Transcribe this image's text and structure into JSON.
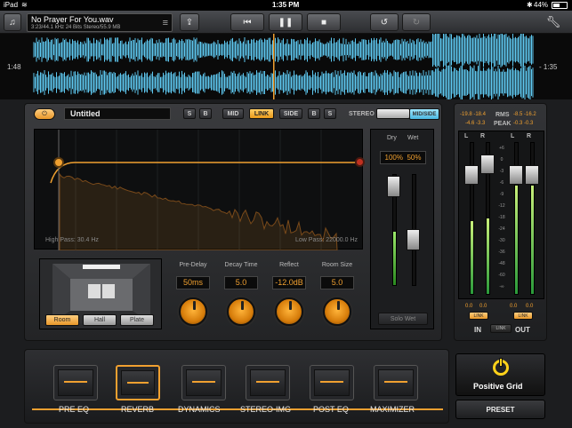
{
  "status": {
    "carrier": "iPad",
    "time": "1:35 PM",
    "battery": "44%"
  },
  "file": {
    "name": "No Prayer For You.wav",
    "details": "3:23/44.1 kHz 24 Bits Stereo/55.9 MB"
  },
  "waveform": {
    "elapsed": "1:48",
    "remaining": "- 1:35",
    "playhead_fraction": 0.48
  },
  "preset": {
    "name": "Untitled"
  },
  "mode_buttons": [
    "S",
    "B",
    "MID",
    "LINK",
    "SIDE",
    "B",
    "S"
  ],
  "stereo": {
    "label": "STEREO",
    "toggle_label": "MID/SIDE"
  },
  "eq_graph": {
    "high_pass": "High Pass: 30.4 Hz",
    "low_pass": "Low Pass: 22000.0 Hz"
  },
  "mix": {
    "dry_label": "Dry",
    "wet_label": "Wet",
    "dry_value": "100%",
    "wet_value": "50%",
    "solo_label": "Solo Wet"
  },
  "room_types": [
    "Room",
    "Hall",
    "Plate"
  ],
  "params": [
    {
      "label": "Pre-Delay",
      "value": "50ms"
    },
    {
      "label": "Decay Time",
      "value": "5.0"
    },
    {
      "label": "Reflect",
      "value": "-12.0dB"
    },
    {
      "label": "Room Size",
      "value": "5.0"
    }
  ],
  "meters": {
    "rms_label": "RMS",
    "peak_label": "PEAK",
    "in_rms": "-19.8 -18.4",
    "out_rms": "-8.5 -16.2",
    "in_peak": "-4.6 -3.3",
    "out_peak": "-0.3 -0.3",
    "channel_labels": [
      "L",
      "R",
      "L",
      "R"
    ],
    "scale": [
      "+6",
      "0",
      "-3",
      "-6",
      "-9",
      "-12",
      "-18",
      "-24",
      "-30",
      "-36",
      "-48",
      "-60",
      "-∞"
    ],
    "in_gain": [
      "0.0",
      "0.0"
    ],
    "out_gain": [
      "0.0",
      "0.0"
    ],
    "link_label": "LINK",
    "in_label": "IN",
    "out_label": "OUT"
  },
  "chain": [
    "PRE EQ",
    "REVERB",
    "DYNAMICS",
    "STEREO-IMG",
    "POST EQ",
    "MAXIMIZER"
  ],
  "brand": {
    "name": "Positive Grid",
    "preset_label": "PRESET"
  },
  "colors": {
    "accent": "#f0a030",
    "wave": "#5ec8f0"
  }
}
